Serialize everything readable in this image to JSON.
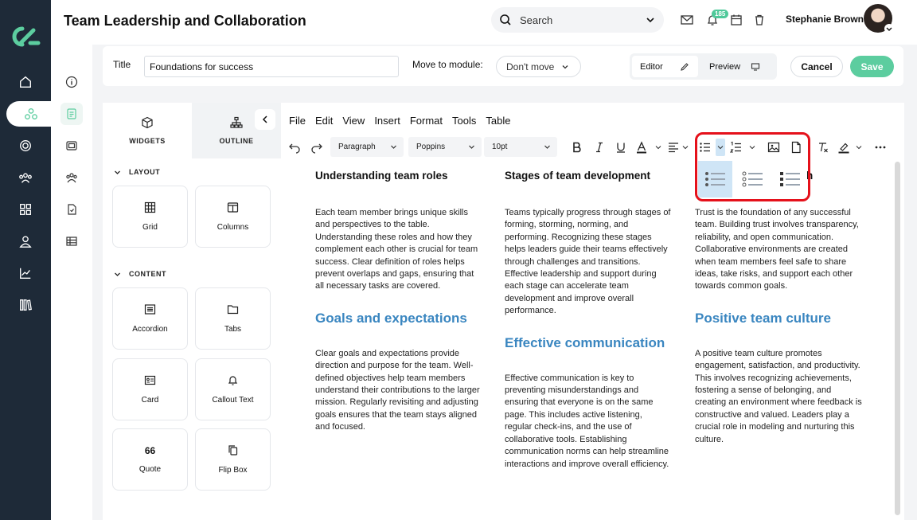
{
  "header": {
    "page_title": "Team Leadership and Collaboration",
    "search_placeholder": "Search",
    "notification_count": "185",
    "user_name": "Stephanie Brown"
  },
  "title_bar": {
    "title_label": "Title",
    "title_value": "Foundations for success",
    "module_label": "Move to module:",
    "module_value": "Don't move",
    "editor_label": "Editor",
    "preview_label": "Preview",
    "cancel_label": "Cancel",
    "save_label": "Save"
  },
  "panel": {
    "tabs": [
      "WIDGETS",
      "OUTLINE"
    ],
    "sections": [
      {
        "label": "LAYOUT",
        "items": [
          "Grid",
          "Columns"
        ]
      },
      {
        "label": "CONTENT",
        "items": [
          "Accordion",
          "Tabs",
          "Card",
          "Callout Text",
          "Quote",
          "Flip Box"
        ]
      }
    ],
    "quote_glyph": "66"
  },
  "editor": {
    "menu": [
      "File",
      "Edit",
      "View",
      "Insert",
      "Format",
      "Tools",
      "Table"
    ],
    "block_format": "Paragraph",
    "font_family": "Poppins",
    "font_size": "10pt",
    "highlight_color": "#e5111b",
    "heading_color": "#3a86c0",
    "columns": [
      {
        "heading": "Understanding team roles",
        "body": "Each team member brings unique skills and perspectives to the table. Understanding these roles and how they complement each other is crucial for team success. Clear definition of roles helps prevent overlaps and gaps, ensuring that all necessary tasks are covered.",
        "heading2": "Goals and expectations",
        "body2": "Clear goals and expectations provide direction and purpose for the team. Well-defined objectives help team members understand their contributions to the larger mission. Regularly revisiting and adjusting goals ensures that the team stays aligned and focused."
      },
      {
        "heading": "Stages of team development",
        "body": "Teams typically progress through stages of forming, storming, norming, and performing. Recognizing these stages helps leaders guide their teams effectively through challenges and transitions. Effective leadership and support during each stage can accelerate team development and improve overall performance.",
        "heading2": "Effective communication",
        "body2": "Effective communication is key to preventing misunderstandings and ensuring that everyone is on the same page. This includes active listening, regular check-ins, and the use of collaborative tools. Establishing communication norms can help streamline interactions and improve overall efficiency."
      },
      {
        "heading": "h",
        "body": "Trust is the foundation of any successful team. Building trust involves transparency, reliability, and open communication. Collaborative environments are created when team members feel safe to share ideas, take risks, and support each other towards common goals.",
        "heading2": "Positive team culture",
        "body2": "A positive team culture promotes engagement, satisfaction, and productivity. This involves recognizing achievements, fostering a sense of belonging, and creating an environment where feedback is constructive and valued. Leaders play a crucial role in modeling and nurturing this culture."
      }
    ]
  },
  "brand_color": "#5ccd9f",
  "rail_color": "#1e2a38"
}
